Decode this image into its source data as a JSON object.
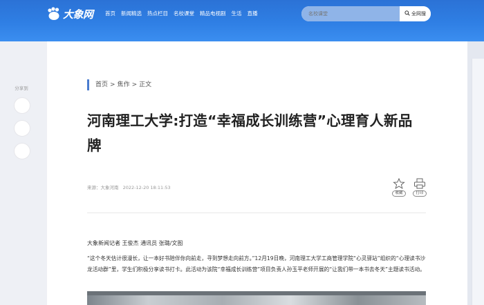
{
  "header": {
    "logo_text": "大象网",
    "nav": [
      "首页",
      "新闻精选",
      "热点栏目",
      "名校课堂",
      "精品电视剧",
      "生活",
      "直播"
    ],
    "search": {
      "placeholder": "名校课堂",
      "button_label": "全网搜"
    }
  },
  "share": {
    "label": "分享到"
  },
  "article": {
    "breadcrumb": {
      "home": "首页",
      "section": "焦作",
      "current": "正文",
      "separator": ">"
    },
    "title": "河南理工大学:打造“幸福成长训练营”心理育人新品牌",
    "meta": {
      "source": "来源：大象河南",
      "date": "2022-12-20 18:11:53"
    },
    "actions": {
      "favorite_label": "收藏",
      "print_label": "打印"
    },
    "byline": "大象新闻记者 王俊杰 通讯员 张璐/文图",
    "paragraph": "“这个冬天估计很漫长，让一本好书陪伴你向前走，寻到梦想走向前方。”12月19日晚，河南理工大学工商管理学院“心灵驿站”组织的“心理读书沙龙活动群”里，学生们积极分享读书打卡。此活动为该院“幸福成长训练营”项目负责人孙玉平老师开展的“让我们带一本书去冬天”主题读书活动。"
  },
  "colors": {
    "header_blue": "#2f7fe4",
    "accent_bar": "#4a7ccf",
    "page_bg": "#eef0f5"
  }
}
